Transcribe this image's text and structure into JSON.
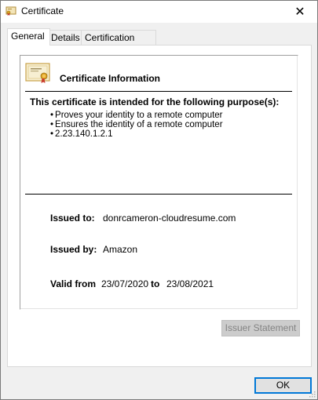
{
  "window": {
    "title": "Certificate",
    "close_glyph": "✕"
  },
  "tabs": [
    {
      "label": "General",
      "active": true
    },
    {
      "label": "Details",
      "active": false
    },
    {
      "label": "Certification Path",
      "active": false
    }
  ],
  "info": {
    "heading": "Certificate Information",
    "purpose_heading": "This certificate is intended for the following purpose(s):",
    "purposes": [
      "Proves your identity to a remote computer",
      "Ensures the identity of a remote computer",
      "2.23.140.1.2.1"
    ],
    "issued_to_label": "Issued to:",
    "issued_to_value": "donrcameron-cloudresume.com",
    "issued_by_label": "Issued by:",
    "issued_by_value": "Amazon",
    "valid_from_label": "Valid from",
    "valid_from_value": "23/07/2020",
    "valid_to_label": "to",
    "valid_to_value": "23/08/2021"
  },
  "buttons": {
    "issuer_statement": "Issuer Statement",
    "ok": "OK"
  },
  "icons": {
    "title_icon": "certificate-icon",
    "cert_icon": "certificate-ribbon-icon",
    "close_icon": "close-icon"
  },
  "colors": {
    "accent": "#0078d7",
    "disabled_text": "#838383"
  }
}
